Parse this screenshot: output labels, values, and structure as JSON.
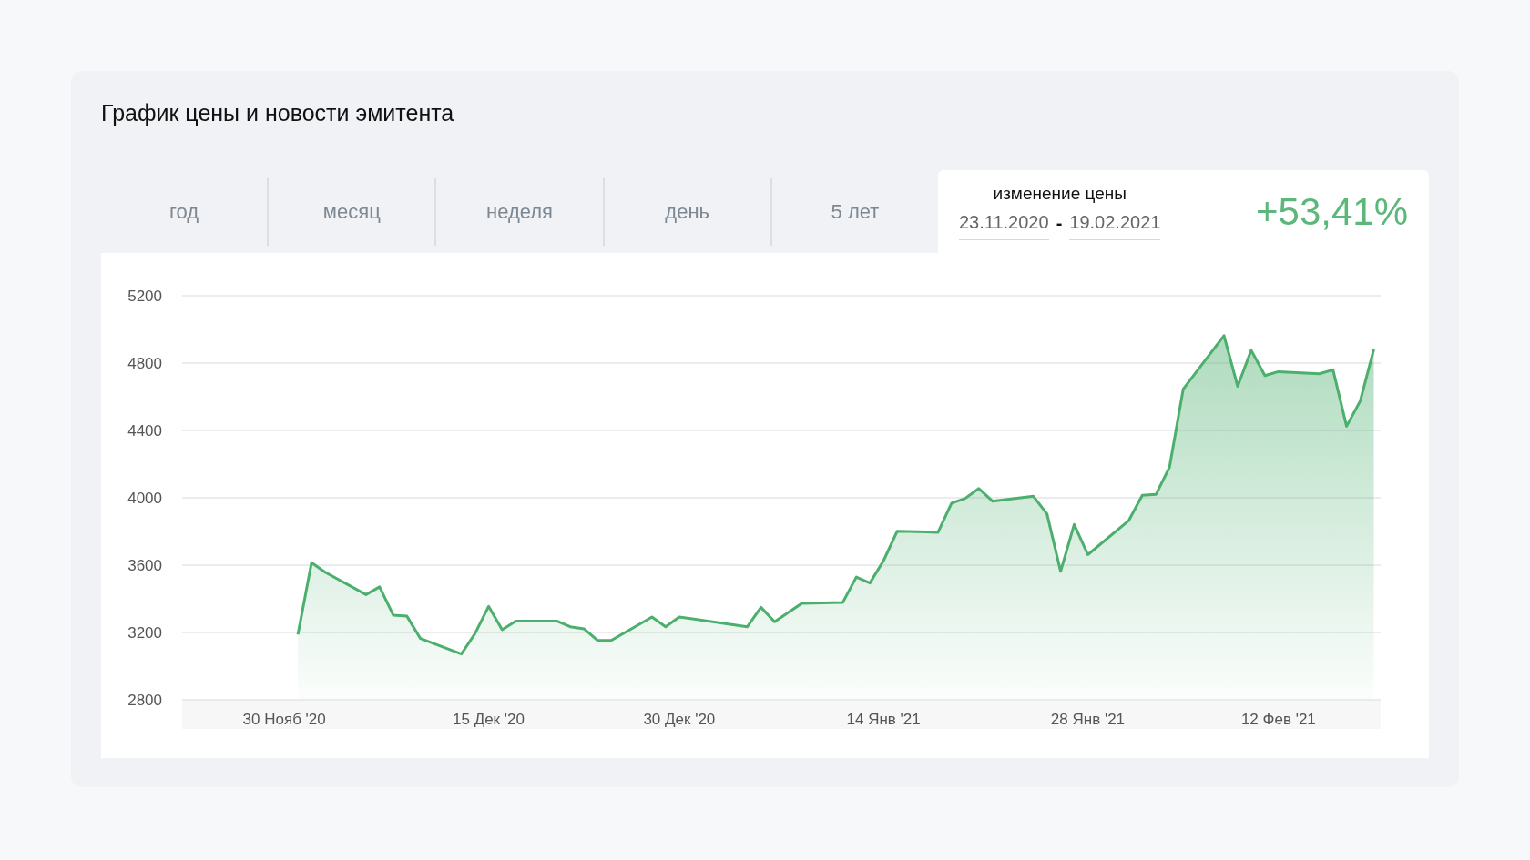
{
  "title": "График цены и новости эмитента",
  "tabs": [
    {
      "label": "год",
      "selected": false
    },
    {
      "label": "месяц",
      "selected": false
    },
    {
      "label": "неделя",
      "selected": false
    },
    {
      "label": "день",
      "selected": false
    },
    {
      "label": "5 лет",
      "selected": false
    }
  ],
  "price_change": {
    "label": "изменение цены",
    "date_from": "23.11.2020",
    "separator": "-",
    "date_to": "19.02.2021",
    "value": "+53,41%"
  },
  "chart_data": {
    "type": "area",
    "grid": true,
    "ylim": [
      2800,
      5200
    ],
    "yticks": [
      2800,
      3200,
      3600,
      4000,
      4400,
      4800,
      5200
    ],
    "categories": [
      null,
      null,
      null,
      null,
      null,
      null,
      null,
      "30 Нояб '20",
      null,
      null,
      null,
      null,
      null,
      null,
      null,
      null,
      null,
      null,
      null,
      null,
      null,
      null,
      "15 Дек '20",
      null,
      null,
      null,
      null,
      null,
      null,
      null,
      null,
      null,
      null,
      null,
      null,
      null,
      "30 Дек '20",
      null,
      null,
      null,
      null,
      null,
      null,
      null,
      null,
      null,
      null,
      null,
      null,
      null,
      null,
      "14 Янв '21",
      null,
      null,
      null,
      null,
      null,
      null,
      null,
      null,
      null,
      null,
      null,
      null,
      null,
      null,
      "28 Янв '21",
      null,
      null,
      null,
      null,
      null,
      null,
      null,
      null,
      null,
      null,
      null,
      null,
      null,
      "12 Фев '21",
      null,
      null,
      null,
      null,
      null,
      null,
      null
    ],
    "series": [
      {
        "color": "#4caf6e",
        "values": [
          null,
          null,
          null,
          null,
          null,
          null,
          null,
          null,
          3188,
          3615,
          3558,
          null,
          null,
          3425,
          3471,
          3303,
          3297,
          3164,
          null,
          null,
          3072,
          3193,
          3355,
          3216,
          3268,
          null,
          null,
          3268,
          3234,
          3222,
          3153,
          3153,
          null,
          null,
          3292,
          3234,
          3292,
          null,
          null,
          null,
          null,
          3234,
          3349,
          3263,
          null,
          3373,
          null,
          null,
          3378,
          3529,
          3494,
          3627,
          3801,
          null,
          null,
          3795,
          3968,
          3997,
          4055,
          3980,
          null,
          null,
          4009,
          3905,
          3563,
          3841,
          3662,
          null,
          null,
          3864,
          4015,
          4020,
          4182,
          4645,
          null,
          null,
          4963,
          4662,
          4876,
          4726,
          4749,
          null,
          null,
          4737,
          4760,
          4425,
          4575,
          4882
        ]
      }
    ]
  }
}
